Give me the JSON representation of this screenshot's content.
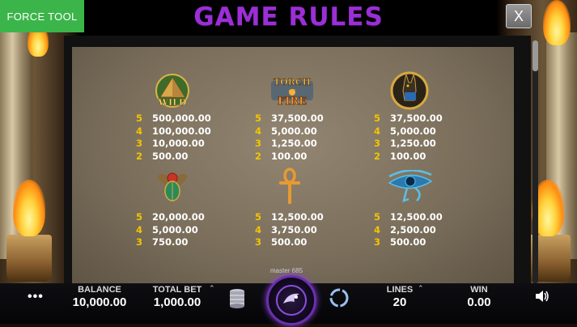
{
  "header": {
    "force_tool_label": "FORCE TOOL",
    "title": "GAME RULES",
    "close_label": "X"
  },
  "paytable": [
    {
      "icon": "pyramid-wild-icon",
      "icon_text": "WILD",
      "pays": [
        {
          "n": "5",
          "v": "500,000.00"
        },
        {
          "n": "4",
          "v": "100,000.00"
        },
        {
          "n": "3",
          "v": "10,000.00"
        },
        {
          "n": "2",
          "v": "500.00"
        }
      ]
    },
    {
      "icon": "torch-of-fire-logo-icon",
      "icon_text": "TORCH OF FIRE",
      "pays": [
        {
          "n": "5",
          "v": "37,500.00"
        },
        {
          "n": "4",
          "v": "5,000.00"
        },
        {
          "n": "3",
          "v": "1,250.00"
        },
        {
          "n": "2",
          "v": "100.00"
        }
      ]
    },
    {
      "icon": "anubis-icon",
      "pays": [
        {
          "n": "5",
          "v": "37,500.00"
        },
        {
          "n": "4",
          "v": "5,000.00"
        },
        {
          "n": "3",
          "v": "1,250.00"
        },
        {
          "n": "2",
          "v": "100.00"
        }
      ]
    },
    {
      "icon": "scarab-icon",
      "pays": [
        {
          "n": "5",
          "v": "20,000.00"
        },
        {
          "n": "4",
          "v": "5,000.00"
        },
        {
          "n": "3",
          "v": "750.00"
        }
      ]
    },
    {
      "icon": "ankh-icon",
      "pays": [
        {
          "n": "5",
          "v": "12,500.00"
        },
        {
          "n": "4",
          "v": "3,750.00"
        },
        {
          "n": "3",
          "v": "500.00"
        }
      ]
    },
    {
      "icon": "eye-of-horus-icon",
      "pays": [
        {
          "n": "5",
          "v": "12,500.00"
        },
        {
          "n": "4",
          "v": "2,500.00"
        },
        {
          "n": "3",
          "v": "500.00"
        }
      ]
    }
  ],
  "watermark": "master 685",
  "bottom_bar": {
    "balance_label": "BALANCE",
    "balance_value": "10,000.00",
    "total_bet_label": "TOTAL BET",
    "total_bet_value": "1,000.00",
    "lines_label": "LINES",
    "lines_value": "20",
    "win_label": "WIN",
    "win_value": "0.00",
    "menu_icon": "ellipsis-icon",
    "coins_icon": "coin-stack-icon",
    "spin_icon": "spin-button-icon",
    "autoplay_icon": "autoplay-icon",
    "sound_icon": "speaker-icon"
  },
  "colors": {
    "title": "#9b2fd6",
    "force_tool_bg": "#3bb54a",
    "multiplier": "#f4c400",
    "spin_ring": "#6b2fb0"
  }
}
